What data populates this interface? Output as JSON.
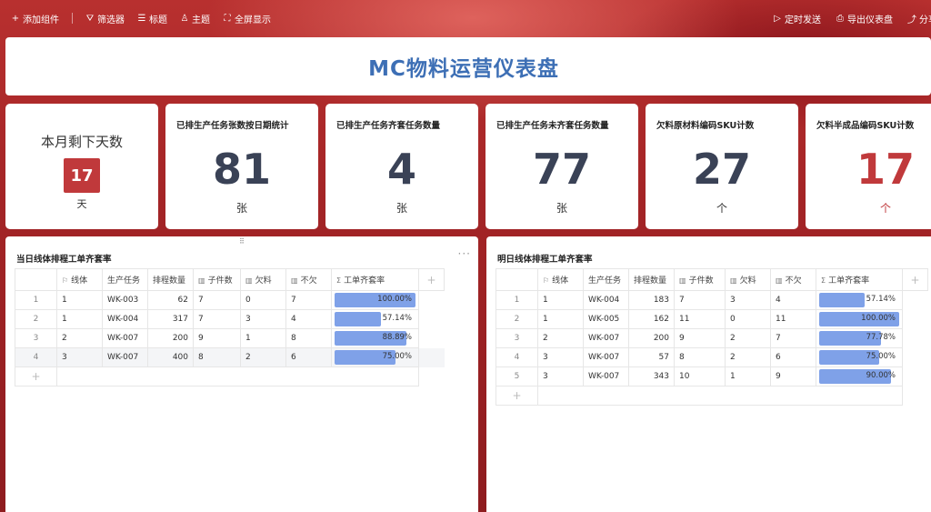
{
  "toolbar": {
    "left": [
      {
        "icon": "plus-icon",
        "glyph": "+",
        "label": "添加组件"
      },
      {
        "icon": "filter-icon",
        "glyph": "⛛",
        "label": "筛选器"
      },
      {
        "icon": "title-icon",
        "glyph": "☰",
        "label": "标题"
      },
      {
        "icon": "theme-icon",
        "glyph": "♙",
        "label": "主题"
      },
      {
        "icon": "fullscreen-icon",
        "glyph": "⛶",
        "label": "全屏显示"
      }
    ],
    "right": [
      {
        "icon": "send-icon",
        "glyph": "▷",
        "label": "定时发送"
      },
      {
        "icon": "export-icon",
        "glyph": "⎙",
        "label": "导出仪表盘"
      },
      {
        "icon": "share-icon",
        "glyph": "⤴",
        "label": "分享"
      }
    ]
  },
  "dashboard_title": "MC物料运营仪表盘",
  "days_card": {
    "title": "本月剩下天数",
    "value": "17",
    "unit": "天"
  },
  "kpis": [
    {
      "title": "已排生产任务张数按日期统计",
      "value": "81",
      "unit": "张"
    },
    {
      "title": "已排生产任务齐套任务数量",
      "value": "4",
      "unit": "张"
    },
    {
      "title": "已排生产任务未齐套任务数量",
      "value": "77",
      "unit": "张"
    },
    {
      "title": "欠料原材料编码SKU计数",
      "value": "27",
      "unit": "个"
    },
    {
      "title": "欠料半成品编码SKU计数",
      "value": "17",
      "unit": "个"
    }
  ],
  "colors": {
    "accent_red": "#c0393b",
    "title_blue": "#3d6fb5",
    "bar_blue": "#7fa1e8",
    "kpi_text": "#3a4256"
  },
  "columns": [
    {
      "icon": "flag-icon",
      "glyph": "⚐",
      "label": "线体"
    },
    {
      "icon": "",
      "glyph": "",
      "label": "生产任务"
    },
    {
      "icon": "",
      "glyph": "",
      "label": "排程数量"
    },
    {
      "icon": "bar-chart-icon",
      "glyph": "▥",
      "label": "子件数"
    },
    {
      "icon": "bar-chart-icon",
      "glyph": "▥",
      "label": "欠料"
    },
    {
      "icon": "bar-chart-icon",
      "glyph": "▥",
      "label": "不欠"
    },
    {
      "icon": "sigma-icon",
      "glyph": "Σ",
      "label": "工单齐套率"
    }
  ],
  "table_today": {
    "title": "当日线体排程工单齐套率",
    "rows": [
      {
        "idx": "1",
        "line": "1",
        "task": "WK-003",
        "qty": "62",
        "parts": "7",
        "short": "0",
        "ok": "7",
        "rate": 100.0,
        "rate_label": "100.00%"
      },
      {
        "idx": "2",
        "line": "1",
        "task": "WK-004",
        "qty": "317",
        "parts": "7",
        "short": "3",
        "ok": "4",
        "rate": 57.14,
        "rate_label": "57.14%"
      },
      {
        "idx": "3",
        "line": "2",
        "task": "WK-007",
        "qty": "200",
        "parts": "9",
        "short": "1",
        "ok": "8",
        "rate": 88.89,
        "rate_label": "88.89%"
      },
      {
        "idx": "4",
        "line": "3",
        "task": "WK-007",
        "qty": "400",
        "parts": "8",
        "short": "2",
        "ok": "6",
        "rate": 75.0,
        "rate_label": "75.00%"
      }
    ]
  },
  "table_tomorrow": {
    "title": "明日线体排程工单齐套率",
    "rows": [
      {
        "idx": "1",
        "line": "1",
        "task": "WK-004",
        "qty": "183",
        "parts": "7",
        "short": "3",
        "ok": "4",
        "rate": 57.14,
        "rate_label": "57.14%"
      },
      {
        "idx": "2",
        "line": "1",
        "task": "WK-005",
        "qty": "162",
        "parts": "11",
        "short": "0",
        "ok": "11",
        "rate": 100.0,
        "rate_label": "100.00%"
      },
      {
        "idx": "3",
        "line": "2",
        "task": "WK-007",
        "qty": "200",
        "parts": "9",
        "short": "2",
        "ok": "7",
        "rate": 77.78,
        "rate_label": "77.78%"
      },
      {
        "idx": "4",
        "line": "3",
        "task": "WK-007",
        "qty": "57",
        "parts": "8",
        "short": "2",
        "ok": "6",
        "rate": 75.0,
        "rate_label": "75.00%"
      },
      {
        "idx": "5",
        "line": "3",
        "task": "WK-007",
        "qty": "343",
        "parts": "10",
        "short": "1",
        "ok": "9",
        "rate": 90.0,
        "rate_label": "90.00%"
      }
    ]
  }
}
